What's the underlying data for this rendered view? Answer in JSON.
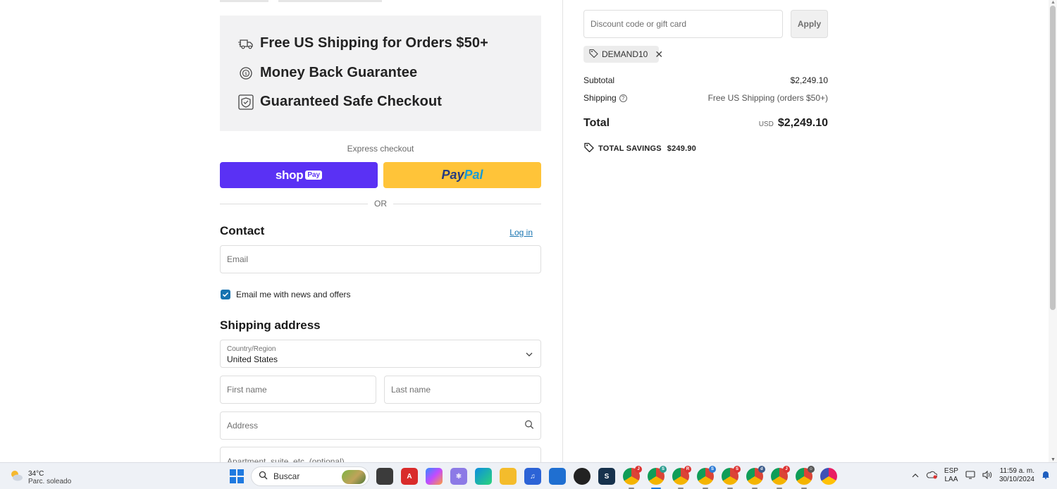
{
  "promo": {
    "items": [
      {
        "icon": "truck-icon",
        "text": "Free US Shipping for Orders $50+"
      },
      {
        "icon": "money-back-icon",
        "text": "Money Back Guarantee"
      },
      {
        "icon": "shield-check-icon",
        "text": "Guaranteed Safe Checkout"
      }
    ]
  },
  "express": {
    "label": "Express checkout",
    "shop_text": "shop",
    "shop_pay_badge": "Pay",
    "paypal_part1": "Pay",
    "paypal_part2": "Pal",
    "or": "OR"
  },
  "contact": {
    "title": "Contact",
    "login": "Log in",
    "email_placeholder": "Email",
    "newsletter_label": "Email me with news and offers",
    "newsletter_checked": true
  },
  "shipping": {
    "title": "Shipping address",
    "country_label": "Country/Region",
    "country_value": "United States",
    "first_name_placeholder": "First name",
    "last_name_placeholder": "Last name",
    "address_placeholder": "Address",
    "apartment_placeholder": "Apartment, suite, etc. (optional)"
  },
  "summary": {
    "discount_placeholder": "Discount code or gift card",
    "apply": "Apply",
    "discount_code": "DEMAND10",
    "subtotal_label": "Subtotal",
    "subtotal_value": "$2,249.10",
    "shipping_label": "Shipping",
    "shipping_value": "Free US Shipping (orders $50+)",
    "total_label": "Total",
    "currency": "USD",
    "total_value": "$2,249.10",
    "savings_label": "TOTAL SAVINGS",
    "savings_value": "$249.90"
  },
  "taskbar": {
    "temp": "34°C",
    "weather": "Parc. soleado",
    "search": "Buscar",
    "lang1": "ESP",
    "lang2": "LAA",
    "time": "11:59 a. m.",
    "date": "30/10/2024"
  },
  "colors": {
    "shop_pay": "#5a31f4",
    "paypal": "#ffc439",
    "link": "#1773b0",
    "promo_bg": "#f2f2f3"
  }
}
